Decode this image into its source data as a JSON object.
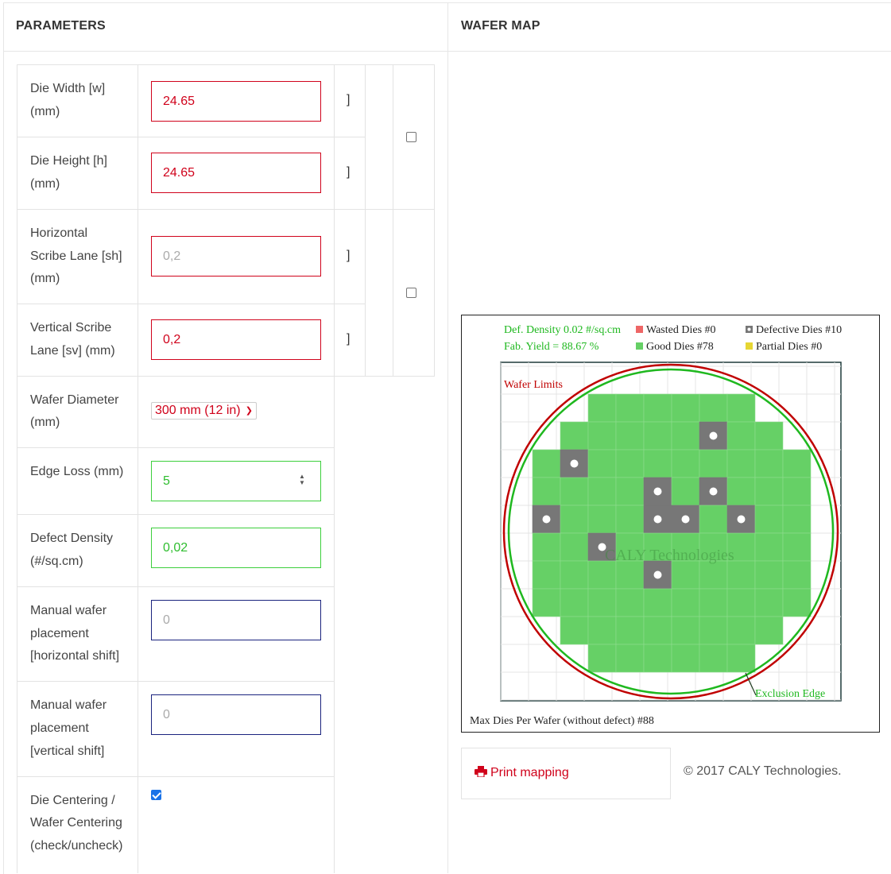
{
  "headers": {
    "parameters": "PARAMETERS",
    "wafer_map": "WAFER MAP"
  },
  "params": {
    "die_width": {
      "label_1": "Die Width [w]",
      "label_2": "(mm)",
      "value": "24.65"
    },
    "die_height": {
      "label_1": "Die Height [h]",
      "label_2": "(mm)",
      "value": "24.65"
    },
    "h_scribe": {
      "label_1": "Horizontal",
      "label_2": "Scribe Lane [sh]",
      "label_3": "(mm)",
      "placeholder": "0,2"
    },
    "v_scribe": {
      "label_1": "Vertical Scribe",
      "label_2": "Lane [sv] (mm)",
      "value": "0,2"
    },
    "wafer_diameter": {
      "label_1": "Wafer Diameter",
      "label_2": "(mm)",
      "selected": "300 mm (12 in)"
    },
    "edge_loss": {
      "label_1": "Edge Loss (mm)",
      "value": "5"
    },
    "defect_density": {
      "label_1": "Defect Density",
      "label_2": "(#/sq.cm)",
      "value": "0,02"
    },
    "manual_h": {
      "label_1": "Manual wafer",
      "label_2": "placement",
      "label_3": "[horizontal shift]",
      "placeholder": "0"
    },
    "manual_v": {
      "label_1": "Manual wafer",
      "label_2": "placement",
      "label_3": "[vertical shift]",
      "placeholder": "0"
    },
    "centering": {
      "label_1": "Die Centering /",
      "label_2": "Wafer Centering",
      "label_3": "(check/uncheck)",
      "checked": true
    },
    "bracket_top": "]",
    "bracket_bottom": "]",
    "link_dims_checked": false,
    "link_scribe_checked": false
  },
  "wafer": {
    "def_density": "Def. Density 0.02 #/sq.cm",
    "fab_yield": "Fab. Yield = 88.67 %",
    "legend": {
      "wasted": "Wasted Dies  #0",
      "good": "Good Dies #78",
      "defective": "Defective Dies  #10",
      "partial": "Partial Dies #0"
    },
    "wafer_limits": "Wafer Limits",
    "exclusion_edge": "Exclusion Edge",
    "watermark": "CALY Technologies",
    "max_dies": "Max Dies Per Wafer (without defect) #88",
    "colors": {
      "good": "#66d066",
      "defective": "#777777",
      "wasted": "#ee6666",
      "partial": "#e6d633",
      "limit": "#c00000",
      "exclusion": "#1fb81f"
    },
    "rows": [
      {
        "from": 3,
        "to": 8
      },
      {
        "from": 2,
        "to": 9
      },
      {
        "from": 1,
        "to": 10
      },
      {
        "from": 1,
        "to": 10
      },
      {
        "from": 1,
        "to": 10
      },
      {
        "from": 1,
        "to": 10
      },
      {
        "from": 1,
        "to": 10
      },
      {
        "from": 1,
        "to": 10
      },
      {
        "from": 2,
        "to": 9
      },
      {
        "from": 3,
        "to": 8
      }
    ],
    "defects": [
      [
        7,
        1
      ],
      [
        2,
        2
      ],
      [
        5,
        3
      ],
      [
        7,
        3
      ],
      [
        1,
        4
      ],
      [
        5,
        4
      ],
      [
        6,
        4
      ],
      [
        8,
        4
      ],
      [
        3,
        5
      ],
      [
        5,
        6
      ]
    ]
  },
  "footer": {
    "print": "Print mapping",
    "copyright": "© 2017 CALY Technologies."
  }
}
